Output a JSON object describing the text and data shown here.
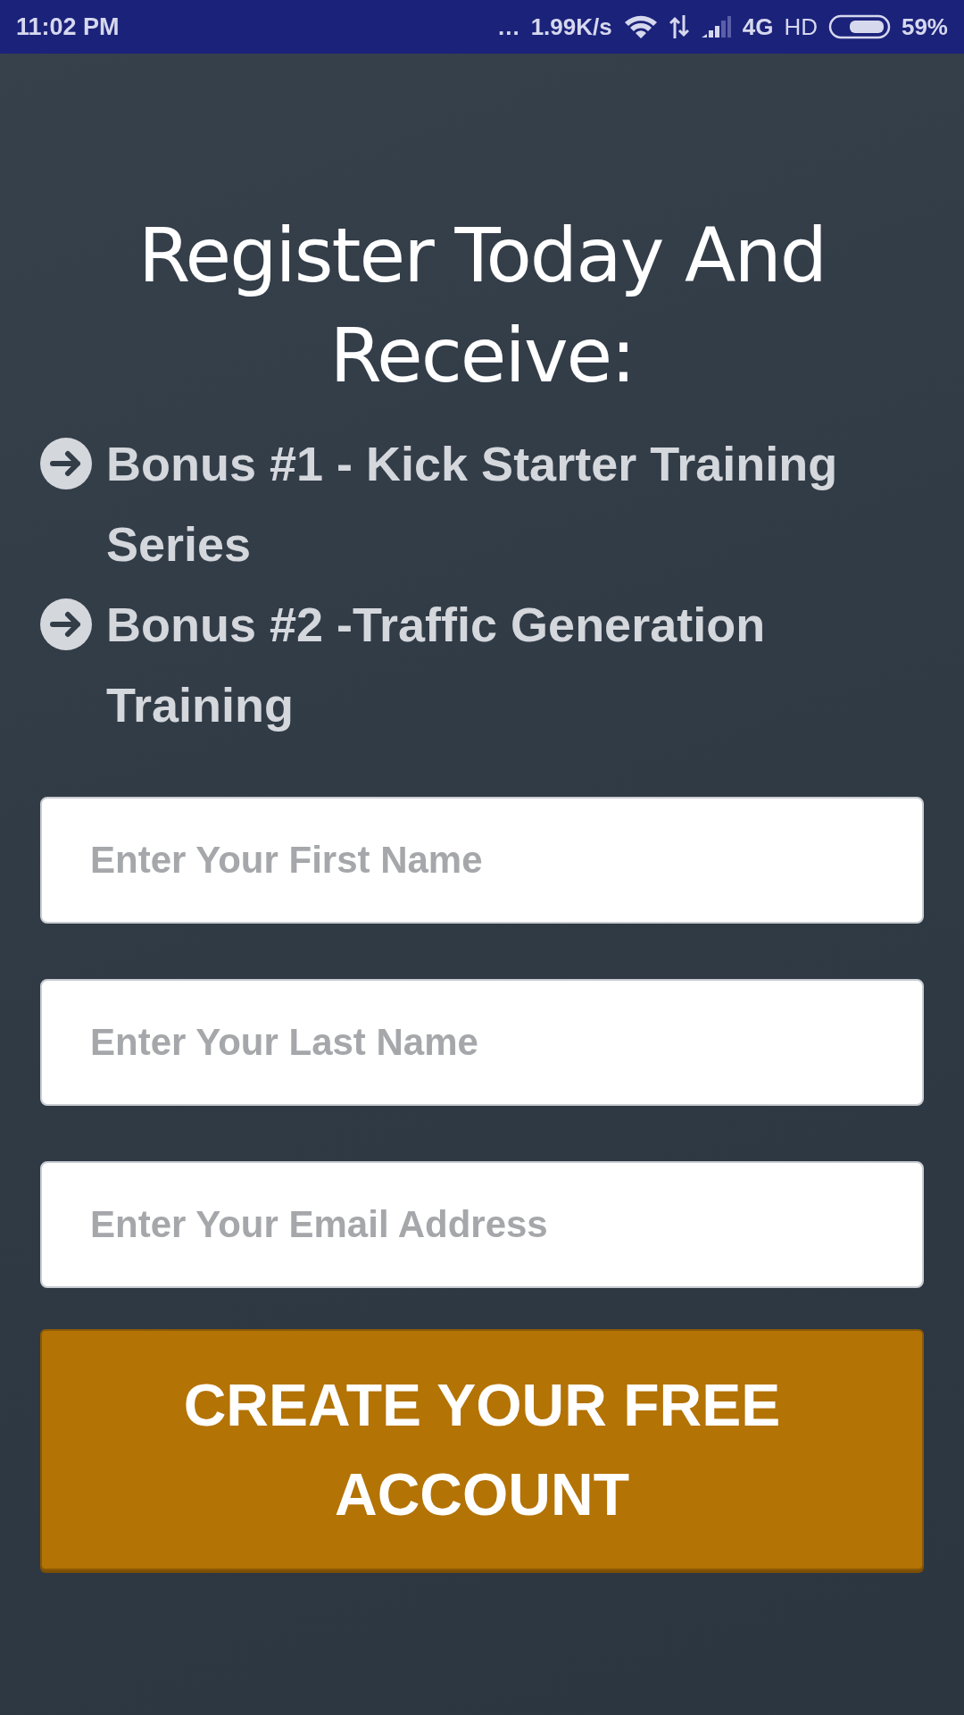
{
  "status_bar": {
    "time": "11:02 PM",
    "dots": "...",
    "speed": "1.99K/s",
    "network": "4G",
    "hd": "HD",
    "battery": "59%"
  },
  "heading": "Register Today And Receive:",
  "bonuses": [
    {
      "text": "Bonus #1 - Kick Starter Training Series"
    },
    {
      "text": "Bonus #2 -Traffic Generation Training"
    }
  ],
  "fields": [
    {
      "placeholder": "Enter Your First Name"
    },
    {
      "placeholder": "Enter Your Last Name"
    },
    {
      "placeholder": "Enter Your Email Address"
    }
  ],
  "button": "CREATE YOUR FREE ACCOUNT"
}
